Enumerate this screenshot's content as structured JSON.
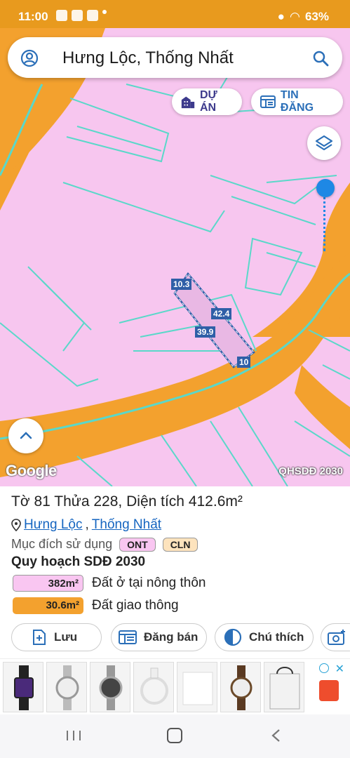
{
  "status_bar": {
    "time": "11:00",
    "battery": "63%"
  },
  "search": {
    "query": "Hưng Lộc, Thống Nhất"
  },
  "map_controls": {
    "project_button": "DỰ ÁN",
    "listing_button": "TIN ĐĂNG",
    "google_label": "Google",
    "layer_label": "QHSDĐ 2030"
  },
  "parcel_dimensions": {
    "top": "10.3",
    "right": "42.4",
    "left": "39.9",
    "bottom": "10"
  },
  "parcel": {
    "title_prefix": "Tờ",
    "sheet": "81",
    "plot_label": "Thửa",
    "plot": "228",
    "area_label": "Diện tích",
    "area": "412.6m²",
    "ward": "Hưng Lộc",
    "district": "Thống Nhất",
    "purpose_label": "Mục đích sử dụng",
    "purpose_tags": [
      "ONT",
      "CLN"
    ],
    "plan_title": "Quy hoạch SDĐ 2030",
    "plan": [
      {
        "area": "382m²",
        "label": "Đất ở tại nông thôn",
        "color": "#f9c6f1"
      },
      {
        "area": "30.6m²",
        "label": "Đất giao thông",
        "color": "#f3a12e"
      }
    ]
  },
  "actions": {
    "save": "Lưu",
    "sell": "Đăng bán",
    "legend": "Chú thích"
  },
  "colors": {
    "map_residential": "#f7c6ef",
    "map_road": "#f3a12e",
    "parcel_line": "#46d4c9",
    "accent_blue": "#1e88e5"
  }
}
